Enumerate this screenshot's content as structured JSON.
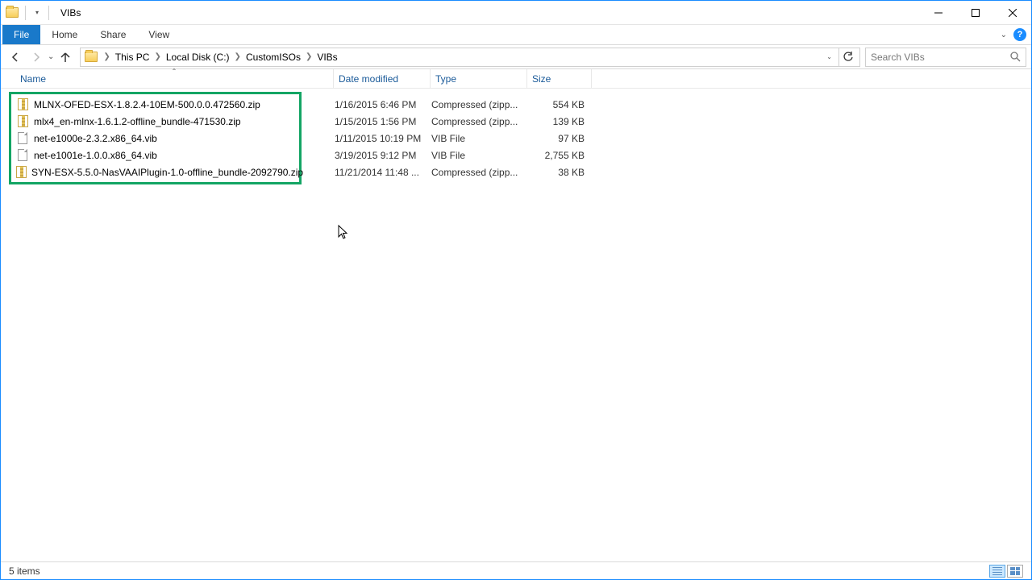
{
  "window": {
    "title": "VIBs"
  },
  "tabs": {
    "file": "File",
    "home": "Home",
    "share": "Share",
    "view": "View"
  },
  "breadcrumb": {
    "item0": "This PC",
    "item1": "Local Disk (C:)",
    "item2": "CustomISOs",
    "item3": "VIBs"
  },
  "search": {
    "placeholder": "Search VIBs"
  },
  "columns": {
    "name": "Name",
    "date": "Date modified",
    "type": "Type",
    "size": "Size"
  },
  "files": [
    {
      "name": "MLNX-OFED-ESX-1.8.2.4-10EM-500.0.0.472560.zip",
      "date": "1/16/2015 6:46 PM",
      "type": "Compressed (zipp...",
      "size": "554 KB",
      "kind": "zip"
    },
    {
      "name": "mlx4_en-mlnx-1.6.1.2-offline_bundle-471530.zip",
      "date": "1/15/2015 1:56 PM",
      "type": "Compressed (zipp...",
      "size": "139 KB",
      "kind": "zip"
    },
    {
      "name": "net-e1000e-2.3.2.x86_64.vib",
      "date": "1/11/2015 10:19 PM",
      "type": "VIB File",
      "size": "97 KB",
      "kind": "file"
    },
    {
      "name": "net-e1001e-1.0.0.x86_64.vib",
      "date": "3/19/2015 9:12 PM",
      "type": "VIB File",
      "size": "2,755 KB",
      "kind": "file"
    },
    {
      "name": "SYN-ESX-5.5.0-NasVAAIPlugin-1.0-offline_bundle-2092790.zip",
      "date": "11/21/2014 11:48 ...",
      "type": "Compressed (zipp...",
      "size": "38 KB",
      "kind": "zip"
    }
  ],
  "status": {
    "count": "5 items"
  }
}
